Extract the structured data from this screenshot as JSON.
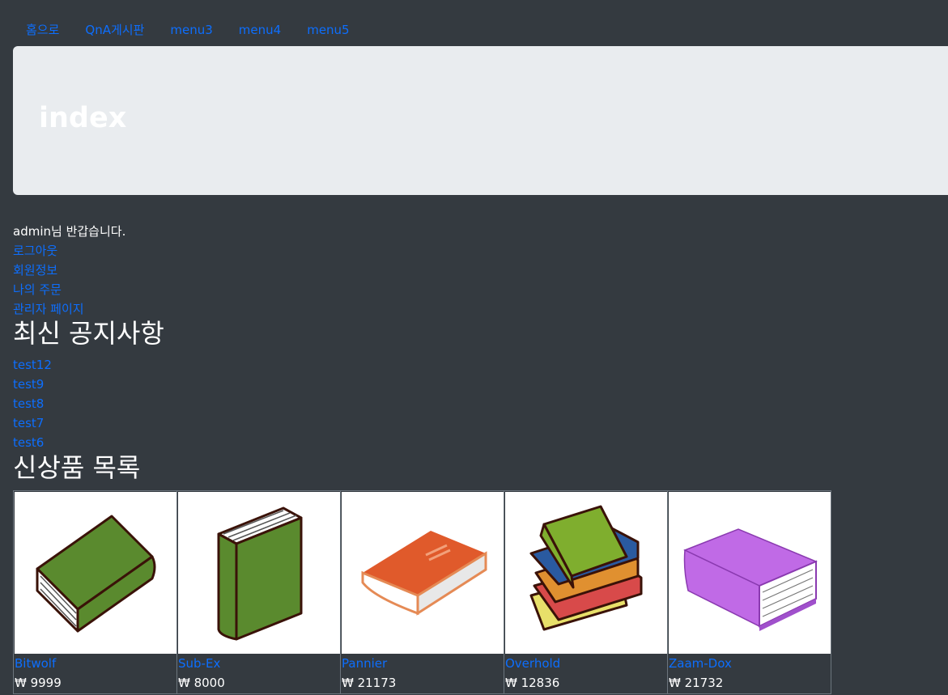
{
  "nav": {
    "items": [
      {
        "label": "홈으로"
      },
      {
        "label": "QnA게시판"
      },
      {
        "label": "menu3"
      },
      {
        "label": "menu4"
      },
      {
        "label": "menu5"
      }
    ]
  },
  "header": {
    "title": "index"
  },
  "user": {
    "welcome": "admin님 반갑습니다.",
    "links": [
      {
        "label": "로그아웃"
      },
      {
        "label": "회원정보"
      },
      {
        "label": "나의 주문"
      },
      {
        "label": "관리자 페이지"
      }
    ]
  },
  "notices": {
    "heading": "최신 공지사항",
    "items": [
      {
        "title": "test12"
      },
      {
        "title": "test9"
      },
      {
        "title": "test8"
      },
      {
        "title": "test7"
      },
      {
        "title": "test6"
      }
    ]
  },
  "products": {
    "heading": "신상품 목록",
    "items": [
      {
        "name": "Bitwolf",
        "price": "₩ 9999",
        "icon": "green-book-lying-icon",
        "color": "#5a8a2e"
      },
      {
        "name": "Sub-Ex",
        "price": "₩ 8000",
        "icon": "green-book-standing-icon",
        "color": "#5a8a2e"
      },
      {
        "name": "Pannier",
        "price": "₩ 21173",
        "icon": "orange-book-icon",
        "color": "#e05a2b"
      },
      {
        "name": "Overhold",
        "price": "₩ 12836",
        "icon": "book-stack-icon",
        "color": "#7fae2e"
      },
      {
        "name": "Zaam-Dox",
        "price": "₩ 21732",
        "icon": "purple-book-icon",
        "color": "#c06ae6"
      }
    ]
  },
  "colors": {
    "background": "#343a40",
    "link": "#0d6efd",
    "jumbotron": "#e9ecef"
  }
}
